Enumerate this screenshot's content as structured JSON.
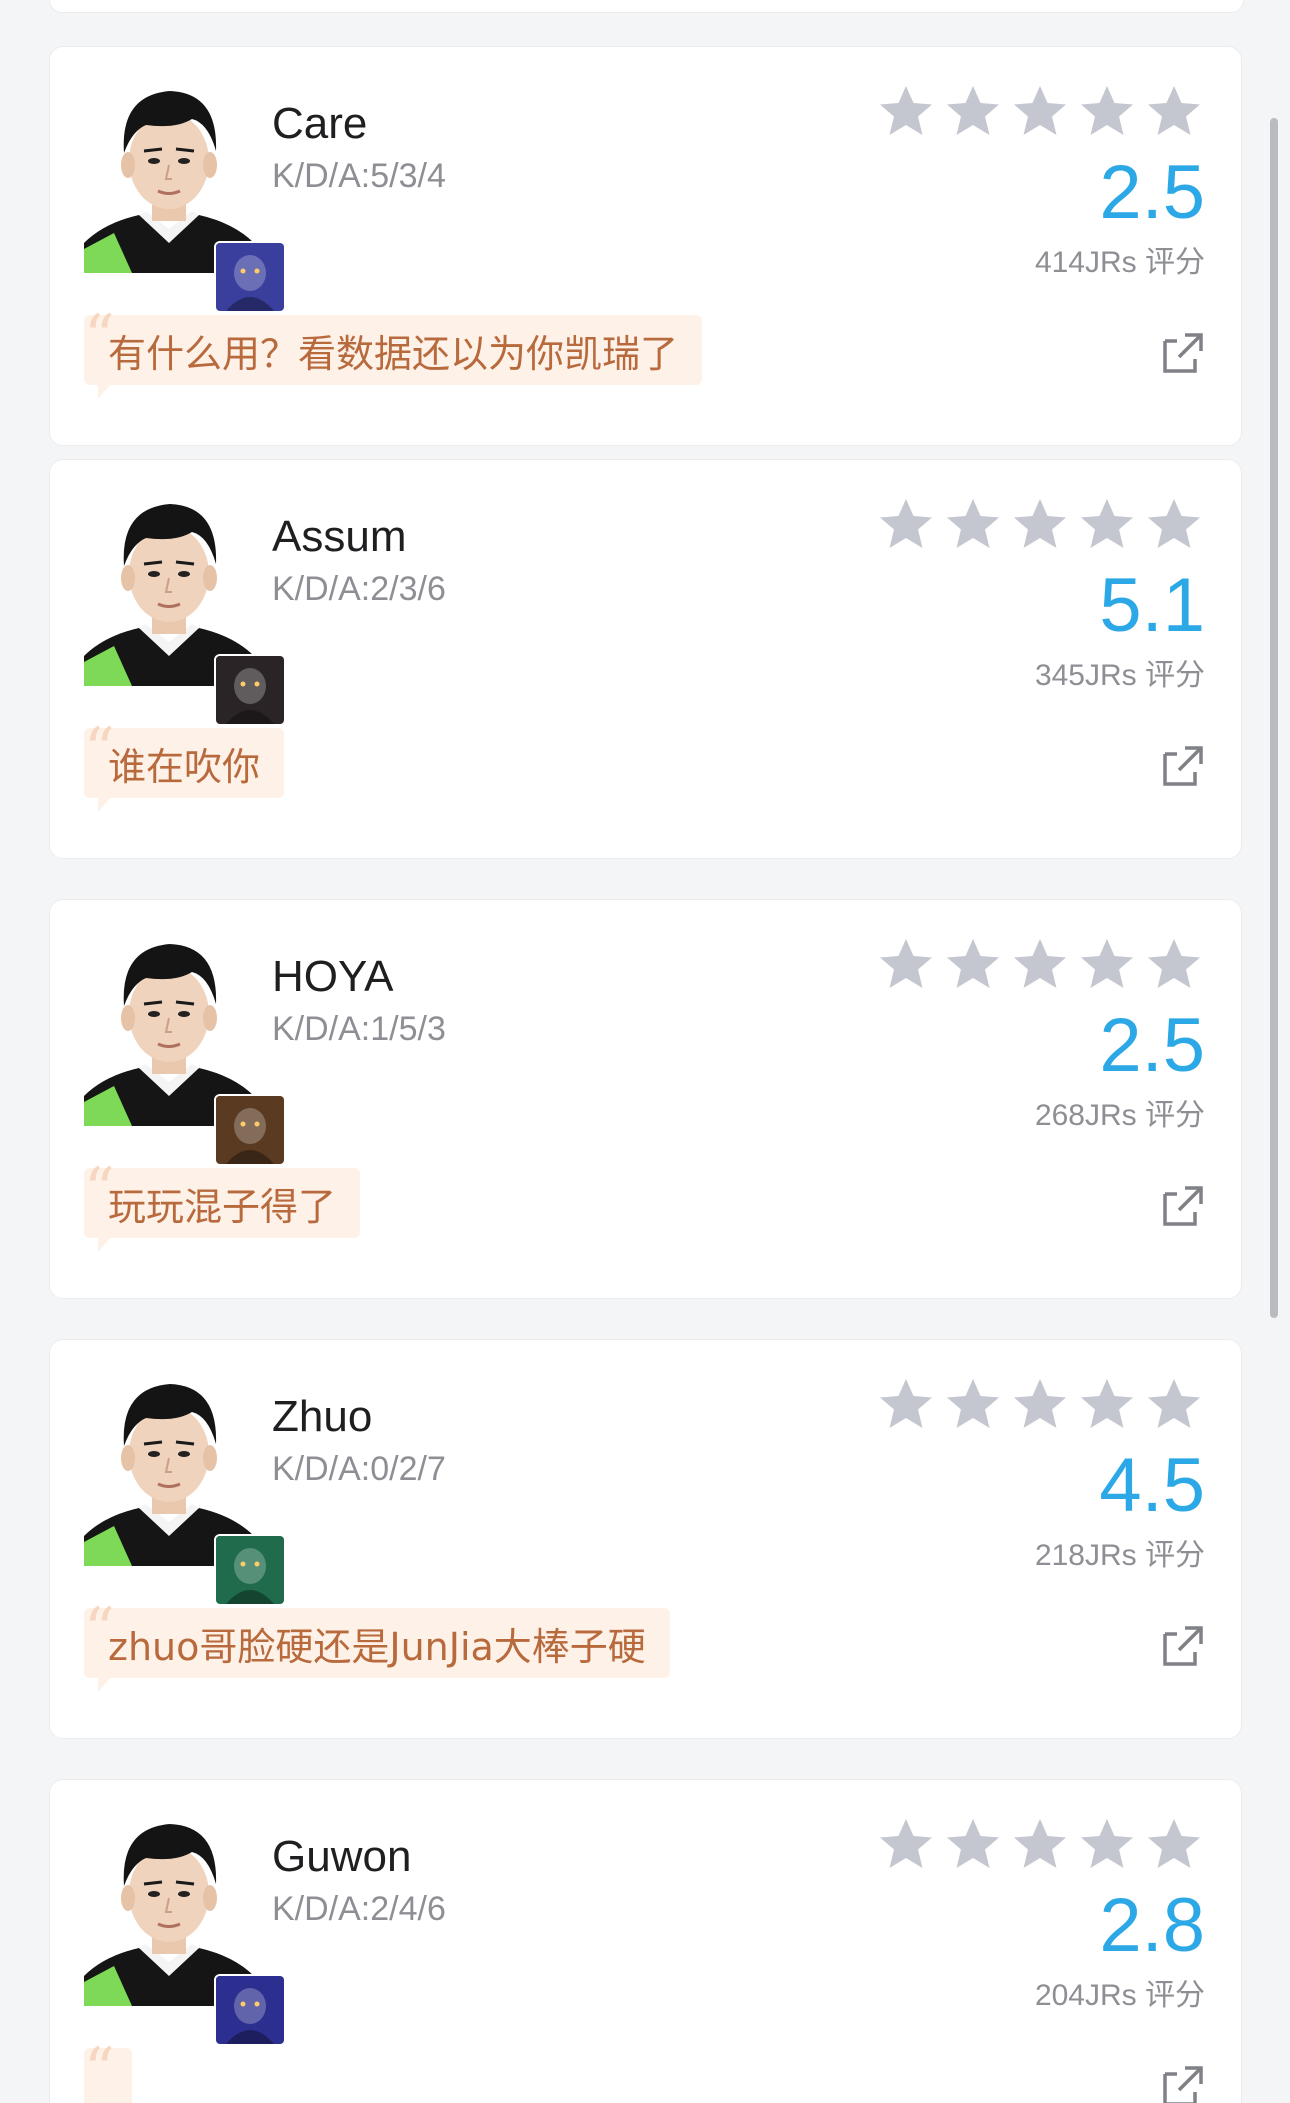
{
  "cards": [
    {
      "name": "Care",
      "kda": "K/D/A:5/3/4",
      "score": "2.5",
      "votes": "414JRs 评分",
      "comment": "有什么用？看数据还以为你凯瑞了",
      "avatar_icon": "player-photo",
      "hero_icon": "champion-portrait",
      "hero_color": "#3a3f9e",
      "stars_filled": 0
    },
    {
      "name": "Assum",
      "kda": "K/D/A:2/3/6",
      "score": "5.1",
      "votes": "345JRs 评分",
      "comment": "谁在吹你",
      "avatar_icon": "player-photo",
      "hero_icon": "champion-portrait",
      "hero_color": "#2b2426",
      "stars_filled": 0
    },
    {
      "name": "HOYA",
      "kda": "K/D/A:1/5/3",
      "score": "2.5",
      "votes": "268JRs 评分",
      "comment": "玩玩混子得了",
      "avatar_icon": "player-photo",
      "hero_icon": "champion-portrait",
      "hero_color": "#5a3b22",
      "stars_filled": 0
    },
    {
      "name": "Zhuo",
      "kda": "K/D/A:0/2/7",
      "score": "4.5",
      "votes": "218JRs 评分",
      "comment": "zhuo哥脸硬还是JunJia大棒子硬",
      "avatar_icon": "player-photo",
      "hero_icon": "champion-portrait",
      "hero_color": "#1f6b4c",
      "stars_filled": 0
    },
    {
      "name": "Guwon",
      "kda": "K/D/A:2/4/6",
      "score": "2.8",
      "votes": "204JRs 评分",
      "comment": "",
      "avatar_icon": "player-photo",
      "hero_icon": "champion-portrait",
      "hero_color": "#2c2f8f",
      "stars_filled": 0
    }
  ],
  "colors": {
    "score": "#2da8e6",
    "star_empty": "#c4c6d0",
    "comment_bg": "#fdf1e8",
    "comment_text": "#b86a3d",
    "jersey_green": "#7ed957"
  },
  "icons": {
    "star": "star-icon",
    "share": "share-external-icon",
    "quote": "quote-icon"
  }
}
